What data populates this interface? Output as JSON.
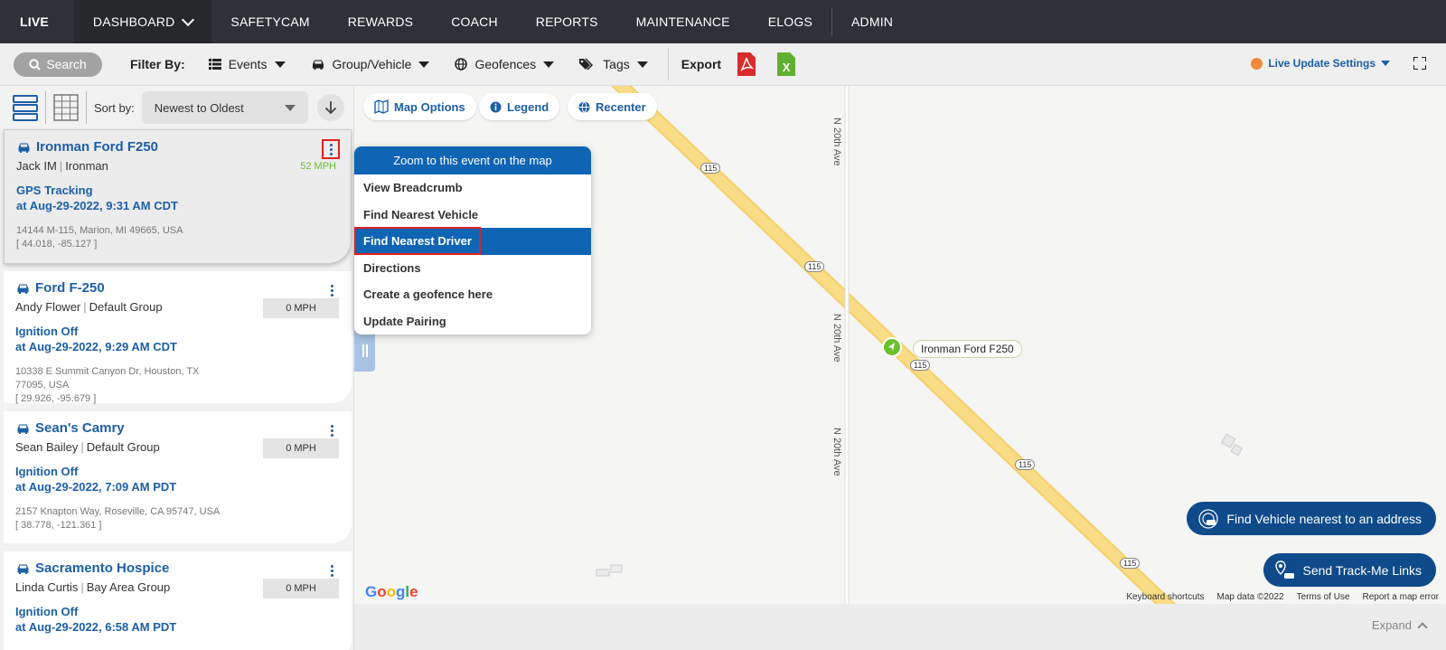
{
  "topnav": {
    "live": "LIVE",
    "dashboard": "DASHBOARD",
    "items": [
      "SAFETYCAM",
      "REWARDS",
      "COACH",
      "REPORTS",
      "MAINTENANCE",
      "ELOGS"
    ],
    "admin": "ADMIN"
  },
  "filterbar": {
    "search": "Search",
    "filter_by": "Filter By:",
    "events": "Events",
    "group_vehicle": "Group/Vehicle",
    "geofences": "Geofences",
    "tags": "Tags",
    "export": "Export",
    "pdf_icon": "pdf-file-icon",
    "excel_icon": "excel-file-icon",
    "excel_letter": "X",
    "live_update": "Live Update Settings",
    "colors": {
      "pdf": "#d92b2b",
      "excel": "#5fb031",
      "live_dot": "#f08a3a"
    }
  },
  "list": {
    "sort_label": "Sort by:",
    "sort_value": "Newest to Oldest",
    "cards": [
      {
        "title": "Ironman Ford F250",
        "driver": "Jack IM",
        "group": "Ironman",
        "speed": "52 MPH",
        "event": "GPS Tracking",
        "time": "at Aug-29-2022, 9:31 AM CDT",
        "address": "14144 M-115, Marion, MI 49665, USA",
        "coords": "[ 44.018, -85.127 ]"
      },
      {
        "title": "Ford F-250",
        "driver": "Andy Flower",
        "group": "Default Group",
        "speed": "0 MPH",
        "event": "Ignition Off",
        "time": "at Aug-29-2022, 9:29 AM CDT",
        "address": "10338 E Summit Canyon Dr, Houston, TX 77095, USA",
        "coords": "[ 29.926, -95.679 ]"
      },
      {
        "title": "Sean's Camry",
        "driver": "Sean Bailey",
        "group": "Default Group",
        "speed": "0 MPH",
        "event": "Ignition Off",
        "time": "at Aug-29-2022, 7:09 AM PDT",
        "address": "2157 Knapton Way, Roseville, CA 95747, USA",
        "coords": "[ 38.778, -121.361 ]"
      },
      {
        "title": "Sacramento Hospice",
        "driver": "Linda Curtis",
        "group": "Bay Area Group",
        "speed": "0 MPH",
        "event": "Ignition Off",
        "time": "at Aug-29-2022, 6:58 AM PDT",
        "address": "",
        "coords": ""
      }
    ]
  },
  "map": {
    "map_options": "Map Options",
    "legend": "Legend",
    "recenter": "Recenter",
    "vehicle_label": "Ironman Ford F250",
    "road_label": "N 20th Ave",
    "route_shield": "115",
    "google": "Google",
    "footer": [
      "Keyboard shortcuts",
      "Map data ©2022",
      "Terms of Use",
      "Report a map error"
    ],
    "expand": "Expand",
    "find_vehicle": "Find Vehicle nearest to an address",
    "send_track": "Send Track-Me Links"
  },
  "context_menu": {
    "header": "Zoom to this event on the map",
    "items": [
      "View Breadcrumb",
      "Find Nearest Vehicle",
      "Find Nearest Driver",
      "Directions",
      "Create a geofence here",
      "Update Pairing"
    ]
  }
}
